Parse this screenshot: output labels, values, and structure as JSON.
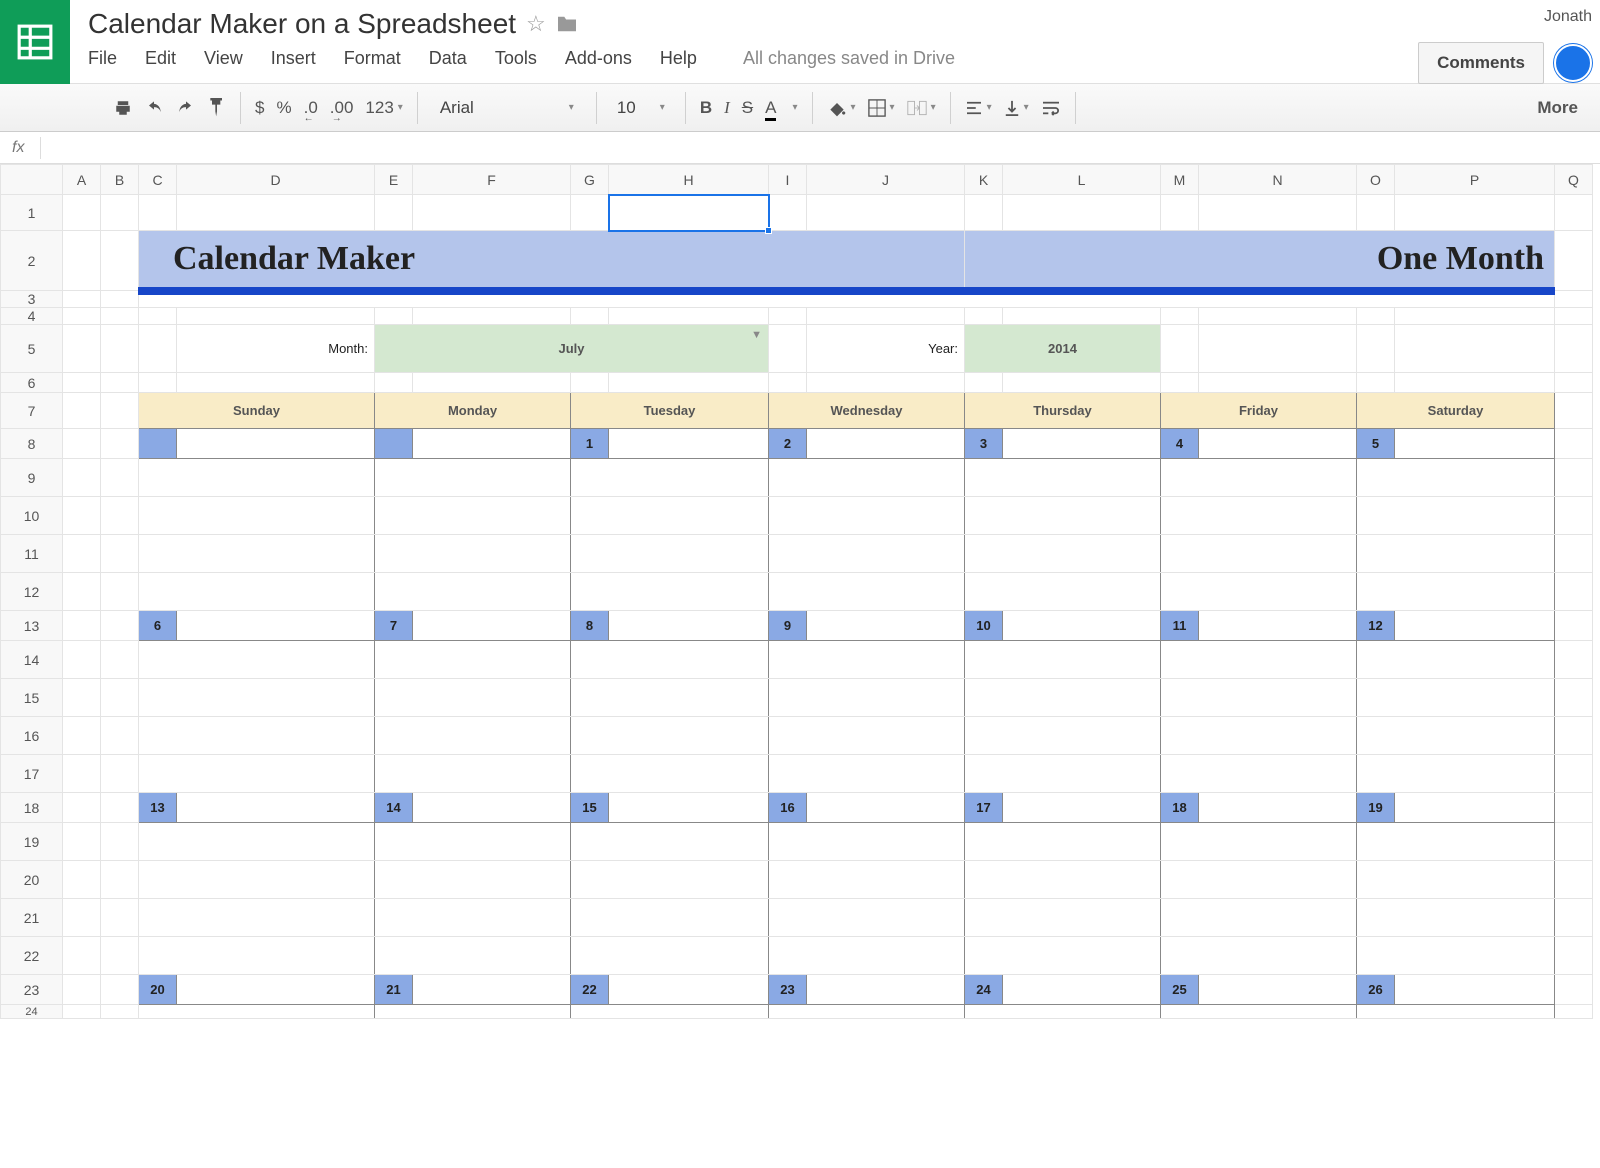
{
  "header": {
    "doc_title": "Calendar Maker on a Spreadsheet",
    "user_name": "Jonath",
    "comments_btn": "Comments",
    "save_status": "All changes saved in Drive"
  },
  "menu": {
    "file": "File",
    "edit": "Edit",
    "view": "View",
    "insert": "Insert",
    "format": "Format",
    "data": "Data",
    "tools": "Tools",
    "addons": "Add-ons",
    "help": "Help"
  },
  "toolbar": {
    "currency": "$",
    "percent": "%",
    "dec_dec": ".0",
    "inc_dec": ".00",
    "numfmt": "123",
    "font": "Arial",
    "size": "10",
    "bold": "B",
    "italic": "I",
    "strike": "S",
    "textcolor": "A",
    "more": "More"
  },
  "formula": {
    "fx": "fx"
  },
  "cols": [
    "A",
    "B",
    "C",
    "D",
    "E",
    "F",
    "G",
    "H",
    "I",
    "J",
    "K",
    "L",
    "M",
    "N",
    "O",
    "P",
    "Q"
  ],
  "rows_visible": [
    "1",
    "2",
    "3",
    "4",
    "5",
    "6",
    "7",
    "8",
    "9",
    "10",
    "11",
    "12",
    "13",
    "14",
    "15",
    "16",
    "17",
    "18",
    "19",
    "20",
    "21",
    "22",
    "23",
    "24"
  ],
  "banner": {
    "left": "Calendar Maker",
    "right": "One Month"
  },
  "select": {
    "month_label": "Month:",
    "month_value": "July",
    "year_label": "Year:",
    "year_value": "2014"
  },
  "days": [
    "Sunday",
    "Monday",
    "Tuesday",
    "Wednesday",
    "Thursday",
    "Friday",
    "Saturday"
  ],
  "weeks": [
    [
      "",
      "",
      "1",
      "2",
      "3",
      "4",
      "5"
    ],
    [
      "6",
      "7",
      "8",
      "9",
      "10",
      "11",
      "12"
    ],
    [
      "13",
      "14",
      "15",
      "16",
      "17",
      "18",
      "19"
    ],
    [
      "20",
      "21",
      "22",
      "23",
      "24",
      "25",
      "26"
    ]
  ]
}
